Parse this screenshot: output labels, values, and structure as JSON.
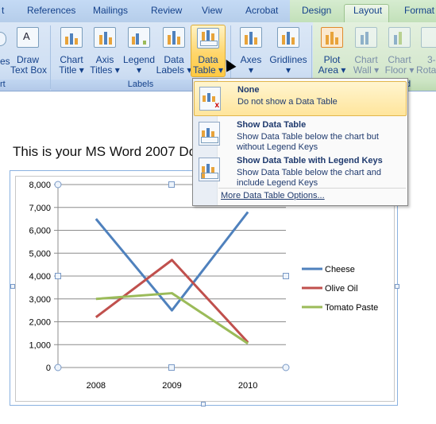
{
  "tabs": {
    "t0": "t",
    "references": "References",
    "mailings": "Mailings",
    "review": "Review",
    "view": "View",
    "acrobat": "Acrobat",
    "design": "Design",
    "layout": "Layout",
    "format": "Format"
  },
  "ribbon": {
    "partial_left_top": "es",
    "partial_left_group": "rt",
    "draw_text_box": [
      "Draw",
      "Text Box"
    ],
    "chart_title": [
      "Chart",
      "Title ▾"
    ],
    "axis_titles": [
      "Axis",
      "Titles ▾"
    ],
    "legend": [
      "Legend",
      "▾"
    ],
    "data_labels": [
      "Data",
      "Labels ▾"
    ],
    "data_table": [
      "Data",
      "Table ▾"
    ],
    "axes": [
      "Axes",
      "▾"
    ],
    "gridlines": [
      "Gridlines",
      "▾"
    ],
    "plot_area": [
      "Plot",
      "Area ▾"
    ],
    "chart_wall": [
      "Chart",
      "Wall ▾"
    ],
    "chart_floor": [
      "Chart",
      "Floor ▾"
    ],
    "rotation": [
      "3-",
      "Rota"
    ],
    "labels_group": "Labels",
    "partial_group_end": "d"
  },
  "document": {
    "title": "This is your MS Word 2007 Do"
  },
  "menu": {
    "items": [
      {
        "title": "None",
        "desc": "Do not show a Data Table"
      },
      {
        "title": "Show Data Table",
        "desc": "Show Data Table below the chart but without Legend Keys"
      },
      {
        "title": "Show Data Table with Legend Keys",
        "desc": "Show Data Table below the chart and include Legend Keys"
      }
    ],
    "more": "More Data Table Options..."
  },
  "chart_data": {
    "type": "line",
    "x": [
      "2008",
      "2009",
      "2010"
    ],
    "series": [
      {
        "name": "Cheese",
        "values": [
          6500,
          2500,
          6800
        ],
        "color": "#4f81bd"
      },
      {
        "name": "Olive Oil",
        "values": [
          2200,
          4700,
          1100
        ],
        "color": "#c0504d"
      },
      {
        "name": "Tomato Paste",
        "values": [
          3000,
          3250,
          1050
        ],
        "color": "#9bbb59"
      }
    ],
    "ylim": [
      0,
      8000
    ],
    "yticks": [
      "0",
      "1,000",
      "2,000",
      "3,000",
      "4,000",
      "5,000",
      "6,000",
      "7,000",
      "8,000"
    ],
    "grid": true,
    "legend_position": "right"
  }
}
